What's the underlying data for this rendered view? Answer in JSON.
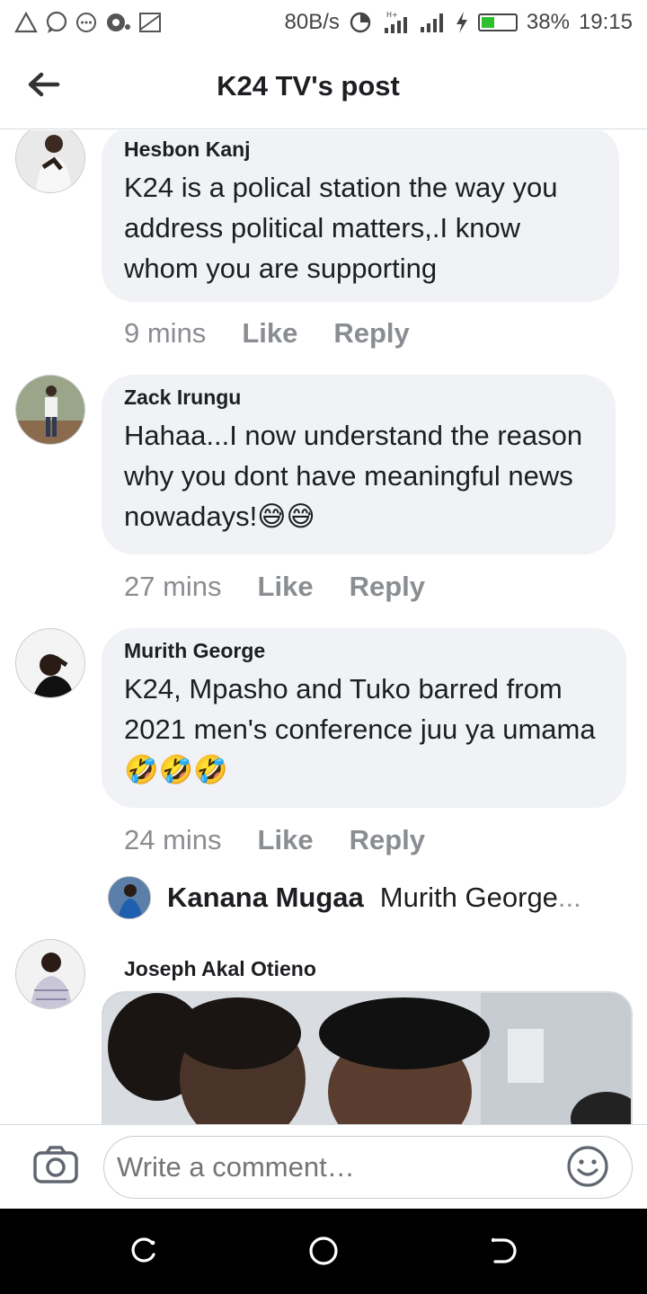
{
  "status_bar": {
    "speed": "80B/s",
    "network_type": "H+",
    "battery_percent": "38%",
    "battery_level": 0.38,
    "time": "19:15"
  },
  "header": {
    "back_icon": "arrow-left-icon",
    "title": "K24 TV's post"
  },
  "comments": [
    {
      "author": "Hesbon Kanj",
      "text": "K24 is a polical station the way you address political matters,.I know whom you are supporting",
      "time": "9 mins",
      "like_label": "Like",
      "reply_label": "Reply"
    },
    {
      "author": "Zack Irungu",
      "text": "Hahaa...I now understand the reason why you dont have meaningful news nowadays!😅😅",
      "time": "27 mins",
      "like_label": "Like",
      "reply_label": "Reply"
    },
    {
      "author": "Murith George",
      "text": "K24, Mpasho  and Tuko barred from 2021 men's conference juu ya umama 🤣🤣🤣",
      "time": "24 mins",
      "like_label": "Like",
      "reply_label": "Reply",
      "reply_preview": {
        "author": "Kanana Mugaa",
        "text": "Murith George",
        "ellipsis": "..."
      }
    },
    {
      "author": "Joseph Akal Otieno"
    }
  ],
  "composer": {
    "placeholder": "Write a comment…",
    "camera_icon": "camera-icon",
    "emoji_icon": "smiley-icon"
  }
}
